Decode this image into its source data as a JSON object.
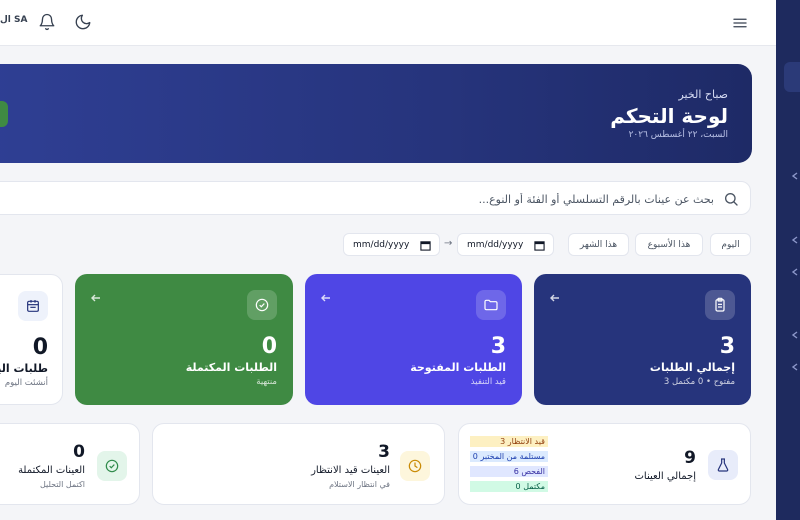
{
  "topbar": {
    "user_initials": "SA",
    "user_label": "ال"
  },
  "hero": {
    "greeting": "صباح الخير",
    "title": "لوحة التحكم",
    "date": "السبت، ٢٢ أغسطس ٢٠٢٦"
  },
  "search": {
    "placeholder": "بحث عن عينات بالرقم التسلسلي أو الفئة أو النوع..."
  },
  "filters": {
    "today": "اليوم",
    "this_week": "هذا الأسبوع",
    "this_month": "هذا الشهر",
    "date_from": "mm/dd/yyyy",
    "date_to": "mm/dd/yyyy",
    "range_arrow": "→"
  },
  "big_cards": [
    {
      "number": "3",
      "title": "إجمالي الطلبات",
      "subtitle": "3 مفتوح • 0 مكتمل",
      "color": "#26347c"
    },
    {
      "number": "3",
      "title": "الطلبات المفتوحة",
      "subtitle": "قيد التنفيذ",
      "color": "#4f46e5"
    },
    {
      "number": "0",
      "title": "الطلبات المكتملة",
      "subtitle": "منتهية",
      "color": "#3f8a43"
    },
    {
      "number": "0",
      "title": "طلبات اليوم",
      "subtitle": "أنشئت اليوم",
      "color": "#ffffff"
    }
  ],
  "small_cards": {
    "total_samples": {
      "number": "9",
      "title": "إجمالي العينات",
      "tags": [
        {
          "text": "3 قيد الانتظار",
          "bg": "#fdf0c2",
          "fg": "#92400e"
        },
        {
          "text": "0 مستلمة من المختبر",
          "bg": "#dbeafe",
          "fg": "#1e40af"
        },
        {
          "text": "6 الفحص",
          "bg": "#e0e7ff",
          "fg": "#3730a3"
        },
        {
          "text": "0 مكتمل",
          "bg": "#d1fae5",
          "fg": "#065f46"
        }
      ]
    },
    "pending_samples": {
      "number": "3",
      "title": "العينات قيد الانتظار",
      "subtitle": "في انتظار الاستلام"
    },
    "completed_samples": {
      "number": "0",
      "title": "العينات المكتملة",
      "subtitle": "اكتمل التحليل"
    }
  }
}
